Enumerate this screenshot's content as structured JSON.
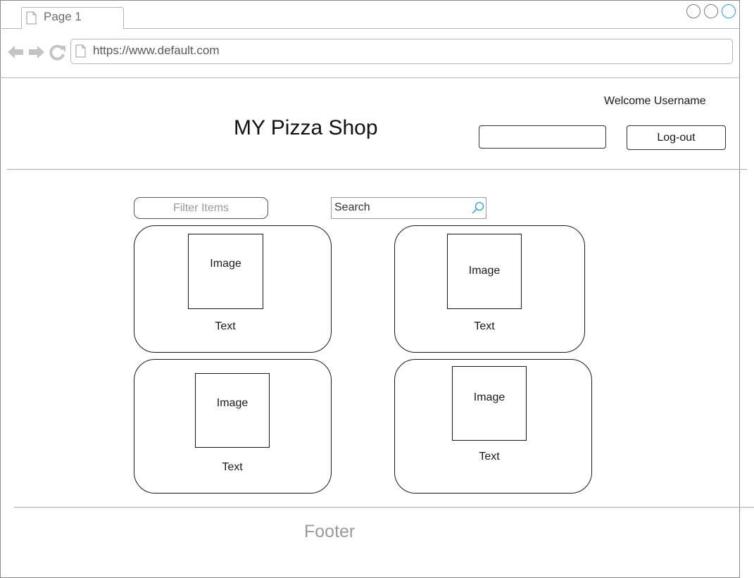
{
  "browser": {
    "tab_label": "Page 1",
    "url": "https://www.default.com",
    "icons": [
      "document-icon",
      "back-arrow-icon",
      "forward-arrow-icon",
      "reload-icon"
    ]
  },
  "header": {
    "welcome": "Welcome Username",
    "title": "MY Pizza Shop",
    "input_value": "",
    "logout_label": "Log-out"
  },
  "controls": {
    "filter_label": "Filter Items",
    "search_text": "Search"
  },
  "cards": [
    {
      "image": "Image",
      "text": "Text"
    },
    {
      "image": "Image",
      "text": "Text"
    },
    {
      "image": "Image",
      "text": "Text"
    },
    {
      "image": "Image",
      "text": "Text"
    }
  ],
  "footer": {
    "label": "Footer"
  },
  "colors": {
    "accent": "#1ba1e2",
    "border": "#1a1a1a",
    "muted": "#9a9a9a"
  }
}
